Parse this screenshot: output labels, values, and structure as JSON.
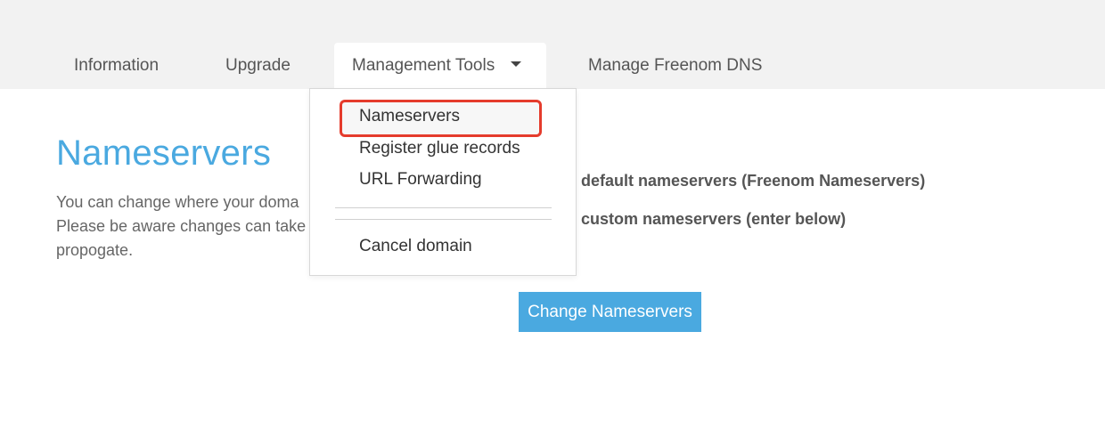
{
  "tabs": {
    "information": "Information",
    "upgrade": "Upgrade",
    "management_tools": "Management Tools",
    "manage_dns": "Manage Freenom DNS"
  },
  "dropdown": {
    "items": {
      "nameservers": "Nameservers",
      "glue_records": "Register glue records",
      "url_forwarding": "URL Forwarding",
      "cancel_domain": "Cancel domain"
    },
    "highlight_color": "#e53b2c"
  },
  "main": {
    "title": "Nameservers",
    "description_lines": [
      "You can change where your doma",
      "Please be aware changes can take",
      "propogate."
    ],
    "options": {
      "default": "default nameservers (Freenom Nameservers)",
      "custom": "custom nameservers (enter below)"
    },
    "submit_label": "Change Nameservers"
  },
  "colors": {
    "accent": "#4aa9e0",
    "tabbar_bg": "#f2f2f2"
  },
  "icons": {
    "dropdown_caret": "caret-down-icon"
  }
}
